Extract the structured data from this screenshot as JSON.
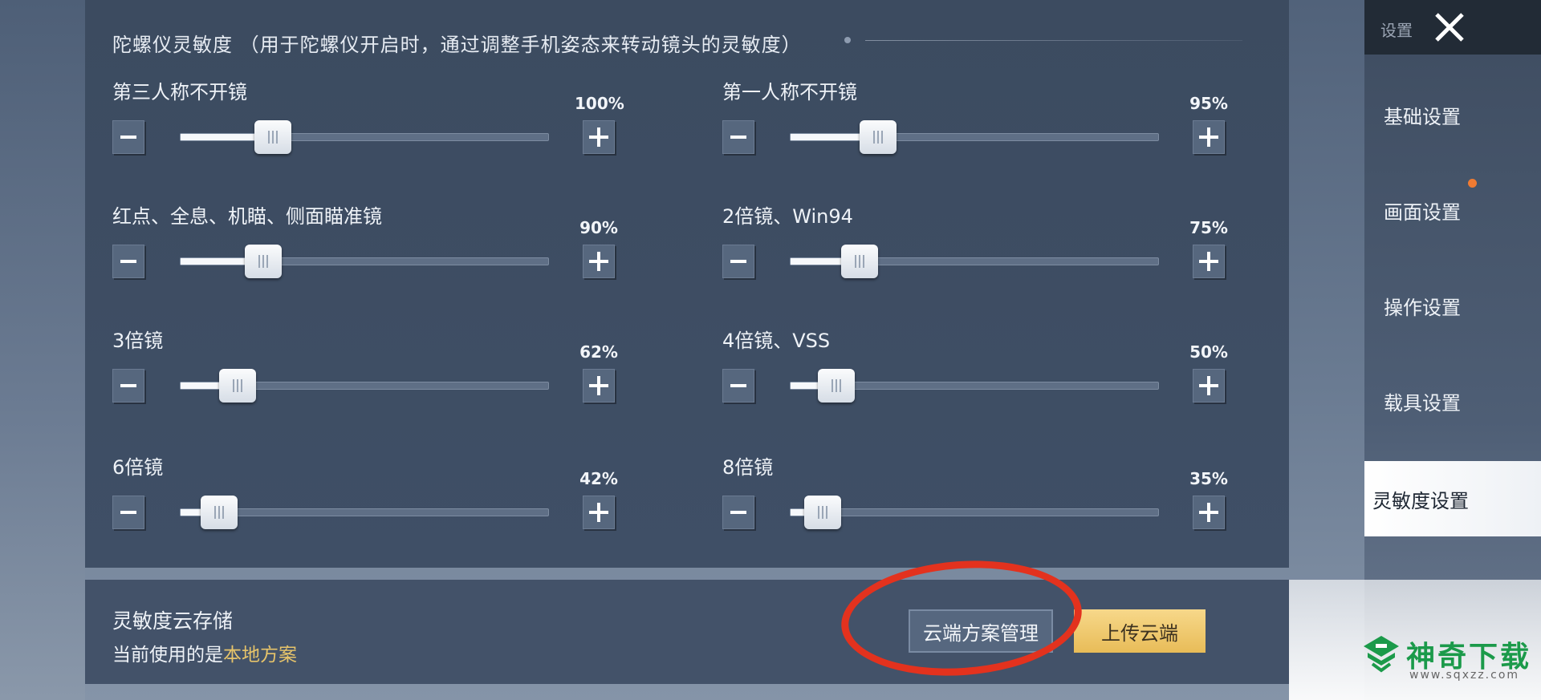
{
  "header": {
    "title": "陀螺仪灵敏度 （用于陀螺仪开启时，通过调整手机姿态来转动镜头的灵敏度）"
  },
  "sliders": [
    {
      "label": "第三人称不开镜",
      "percent_text": "100%",
      "value": 100
    },
    {
      "label": "第一人称不开镜",
      "percent_text": "95%",
      "value": 95
    },
    {
      "label": "红点、全息、机瞄、侧面瞄准镜",
      "percent_text": "90%",
      "value": 90
    },
    {
      "label": "2倍镜、Win94",
      "percent_text": "75%",
      "value": 75
    },
    {
      "label": "3倍镜",
      "percent_text": "62%",
      "value": 62
    },
    {
      "label": "4倍镜、VSS",
      "percent_text": "50%",
      "value": 50
    },
    {
      "label": "6倍镜",
      "percent_text": "42%",
      "value": 42
    },
    {
      "label": "8倍镜",
      "percent_text": "35%",
      "value": 35
    }
  ],
  "stepper": {
    "minus": "−",
    "plus": "+"
  },
  "cloud": {
    "title": "灵敏度云存储",
    "status_prefix": "当前使用的是",
    "status_value": "本地方案",
    "manage_label": "云端方案管理",
    "upload_label": "上传云端"
  },
  "sidebar": {
    "top_label": "设置",
    "items": [
      {
        "label": "基础设置"
      },
      {
        "label": "画面设置"
      },
      {
        "label": "操作设置"
      },
      {
        "label": "载具设置"
      },
      {
        "label": "灵敏度设置"
      }
    ]
  },
  "watermark": {
    "brand": "神奇下载",
    "url": "www.sqxzz.com"
  },
  "colors": {
    "accent_orange": "#f07b32",
    "highlight_red": "#e3321e",
    "upload_yellow": "#e8bc58",
    "status_gold": "#e7c46a",
    "watermark_green": "#1b9a4a"
  }
}
